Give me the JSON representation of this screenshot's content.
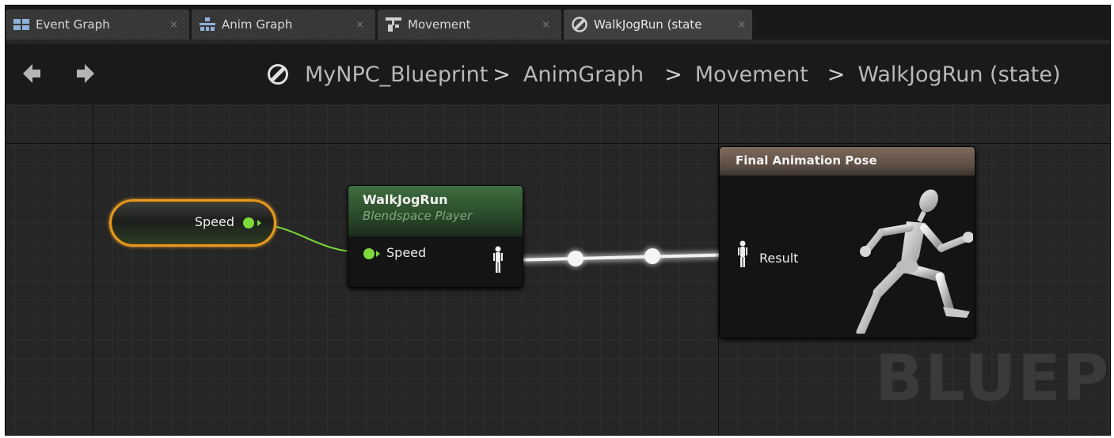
{
  "tabs": [
    {
      "label": "Event Graph",
      "icon": "event-graph-icon",
      "active": false
    },
    {
      "label": "Anim Graph",
      "icon": "anim-graph-icon",
      "active": false
    },
    {
      "label": "Movement",
      "icon": "state-machine-icon",
      "active": false
    },
    {
      "label": "WalkJogRun (state",
      "icon": "state-icon",
      "active": true
    }
  ],
  "tab_close_glyph": "×",
  "breadcrumb": {
    "icon": "state-icon",
    "items": [
      "MyNPC_Blueprint",
      "AnimGraph",
      "Movement",
      "WalkJogRun (state)"
    ],
    "separator": ">"
  },
  "nodes": {
    "speed_getter": {
      "label": "Speed"
    },
    "blendspace": {
      "title": "WalkJogRun",
      "subtitle": "Blendspace Player",
      "input_label": "Speed"
    },
    "final_pose": {
      "title": "Final Animation Pose",
      "input_label": "Result"
    }
  },
  "watermark": "BLUEPR",
  "colors": {
    "float_pin": "#7ed93a",
    "selection": "#e49a22",
    "blend_header": "#3f6d3f",
    "pose_header": "#7d6a5c"
  }
}
